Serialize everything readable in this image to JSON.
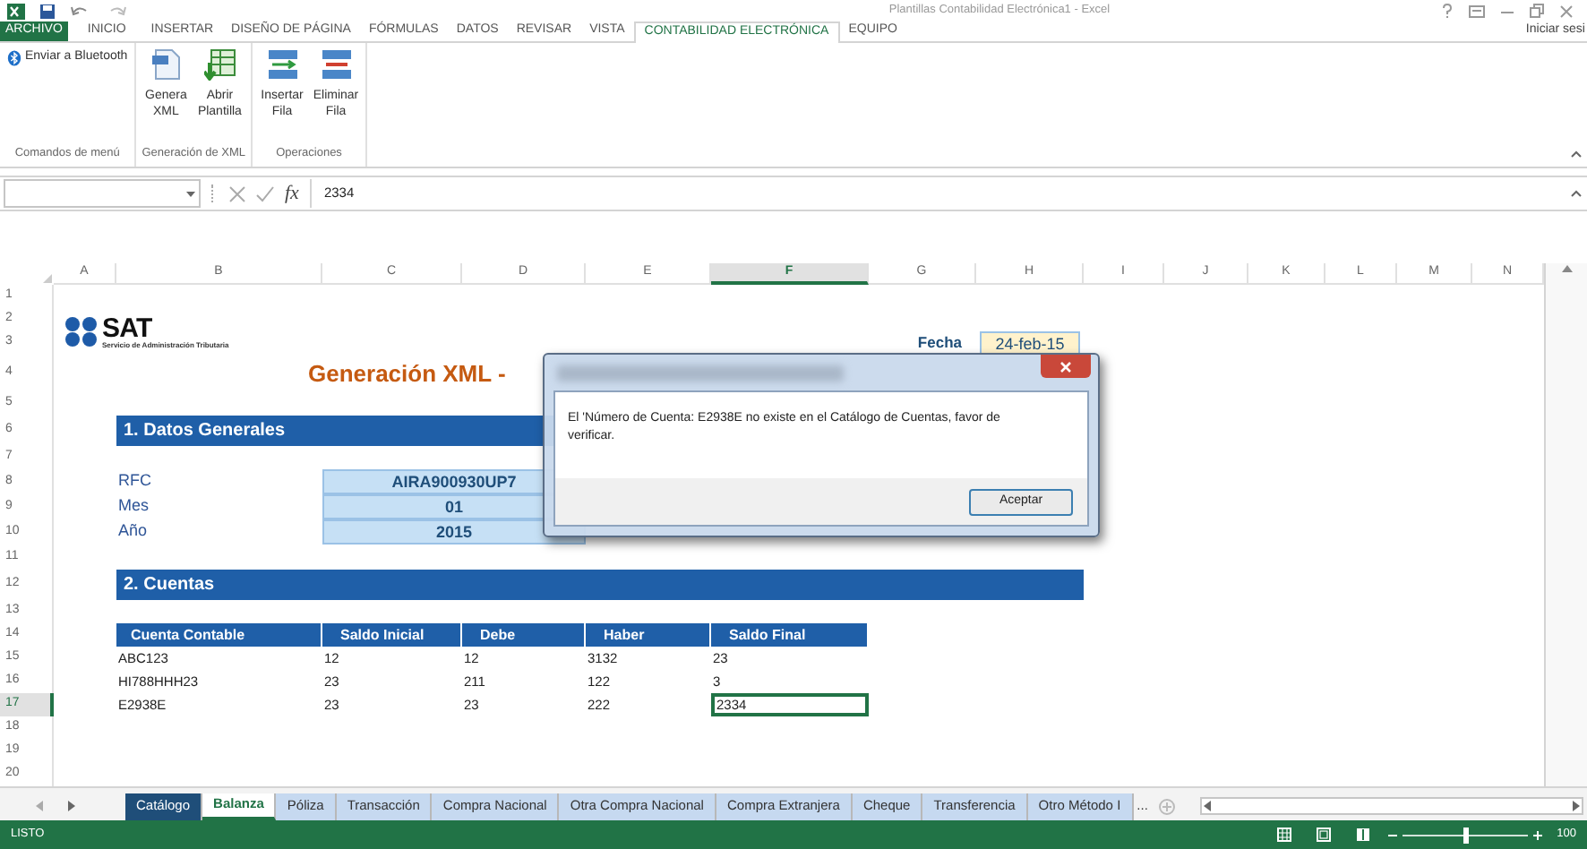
{
  "window": {
    "title": "Plantillas Contabilidad Electrónica1 - Excel",
    "account": "Iniciar sesi"
  },
  "ribbon_tabs": [
    {
      "label": "ARCHIVO",
      "kind": "file",
      "selected": false
    },
    {
      "label": "INICIO",
      "kind": "tab",
      "selected": false
    },
    {
      "label": "INSERTAR",
      "kind": "tab",
      "selected": false
    },
    {
      "label": "DISEÑO DE PÁGINA",
      "kind": "tab",
      "selected": false
    },
    {
      "label": "FÓRMULAS",
      "kind": "tab",
      "selected": false
    },
    {
      "label": "DATOS",
      "kind": "tab",
      "selected": false
    },
    {
      "label": "REVISAR",
      "kind": "tab",
      "selected": false
    },
    {
      "label": "VISTA",
      "kind": "tab",
      "selected": false
    },
    {
      "label": "CONTABILIDAD ELECTRÓNICA",
      "kind": "tab",
      "selected": true
    },
    {
      "label": "EQUIPO",
      "kind": "tab",
      "selected": false
    }
  ],
  "ribbon_groups": [
    {
      "label": "Comandos de menú",
      "buttons": [
        {
          "label": "Enviar a Bluetooth",
          "kind": "bluetooth"
        }
      ]
    },
    {
      "label": "Generación de XML",
      "buttons": [
        {
          "label": "Genera XML",
          "kind": "document"
        },
        {
          "label": "Abrir Plantilla",
          "kind": "template"
        }
      ]
    },
    {
      "label": "Operaciones",
      "buttons": [
        {
          "label": "Insertar Fila",
          "kind": "insert"
        },
        {
          "label": "Eliminar Fila",
          "kind": "delete"
        }
      ]
    }
  ],
  "formula_bar": {
    "function_label": "fx",
    "value": "2334"
  },
  "column_headers": [
    {
      "label": "A",
      "selected": false
    },
    {
      "label": "B",
      "selected": false
    },
    {
      "label": "C",
      "selected": false
    },
    {
      "label": "D",
      "selected": false
    },
    {
      "label": "E",
      "selected": false
    },
    {
      "label": "F",
      "selected": true
    },
    {
      "label": "G",
      "selected": false
    },
    {
      "label": "H",
      "selected": false
    },
    {
      "label": "I",
      "selected": false
    },
    {
      "label": "J",
      "selected": false
    },
    {
      "label": "K",
      "selected": false
    },
    {
      "label": "L",
      "selected": false
    },
    {
      "label": "M",
      "selected": false
    },
    {
      "label": "N",
      "selected": false
    }
  ],
  "row_headers": [
    {
      "label": "1",
      "selected": false
    },
    {
      "label": "2",
      "selected": false
    },
    {
      "label": "3",
      "selected": false
    },
    {
      "label": "4",
      "selected": false
    },
    {
      "label": "5",
      "selected": false
    },
    {
      "label": "6",
      "selected": false
    },
    {
      "label": "7",
      "selected": false
    },
    {
      "label": "8",
      "selected": false
    },
    {
      "label": "9",
      "selected": false
    },
    {
      "label": "10",
      "selected": false
    },
    {
      "label": "11",
      "selected": false
    },
    {
      "label": "12",
      "selected": false
    },
    {
      "label": "13",
      "selected": false
    },
    {
      "label": "14",
      "selected": false
    },
    {
      "label": "15",
      "selected": false
    },
    {
      "label": "16",
      "selected": false
    },
    {
      "label": "17",
      "selected": true
    },
    {
      "label": "18",
      "selected": false
    },
    {
      "label": "19",
      "selected": false
    },
    {
      "label": "20",
      "selected": false
    }
  ],
  "sheet": {
    "logo": {
      "name": "SAT",
      "subtitle": "Servicio de Administración Tributaria"
    },
    "title": "Generación XML -",
    "date": {
      "label": "Fecha",
      "value": "24-feb-15"
    },
    "section_1": "1. Datos Generales",
    "fields": [
      {
        "label": "RFC",
        "value": "AIRA900930UP7"
      },
      {
        "label": "Mes",
        "value": "01"
      },
      {
        "label": "Año",
        "value": "2015"
      }
    ],
    "section_2": "2. Cuentas",
    "table": {
      "columns": [
        "Cuenta Contable",
        "Saldo Inicial",
        "Debe",
        "Haber",
        "Saldo Final"
      ],
      "rows": [
        {
          "cells": [
            "ABC123",
            "12",
            "12",
            "3132",
            "23"
          ],
          "selected": false
        },
        {
          "cells": [
            "HI788HHH23",
            "23",
            "211",
            "122",
            "3"
          ],
          "selected": false
        },
        {
          "cells": [
            "E2938E",
            "23",
            "23",
            "222",
            "2334"
          ],
          "selected": true
        }
      ]
    }
  },
  "dialog": {
    "message": "El 'Número de Cuenta: E2938E no existe en el Catálogo de Cuentas, favor de verificar.",
    "button": "Aceptar"
  },
  "sheet_tabs": [
    {
      "label": "Catálogo",
      "color": "#1f4e79",
      "selected": false
    },
    {
      "label": "Balanza",
      "color": "#ffffff",
      "selected": true
    },
    {
      "label": "Póliza",
      "color": "#c6d9f0",
      "selected": false
    },
    {
      "label": "Transacción",
      "color": "#c6d9f0",
      "selected": false
    },
    {
      "label": "Compra Nacional",
      "color": "#c6d9f0",
      "selected": false
    },
    {
      "label": "Otra Compra Nacional",
      "color": "#c6d9f0",
      "selected": false
    },
    {
      "label": "Compra Extranjera",
      "color": "#c6d9f0",
      "selected": false
    },
    {
      "label": "Cheque",
      "color": "#c6d9f0",
      "selected": false
    },
    {
      "label": "Transferencia",
      "color": "#c6d9f0",
      "selected": false
    },
    {
      "label": "Otro Método I",
      "color": "#c6d9f0",
      "selected": false
    }
  ],
  "more_tabs": "...",
  "status_bar": {
    "status": "LISTO",
    "zoom": {
      "level": 0.5,
      "reading": "100"
    }
  }
}
